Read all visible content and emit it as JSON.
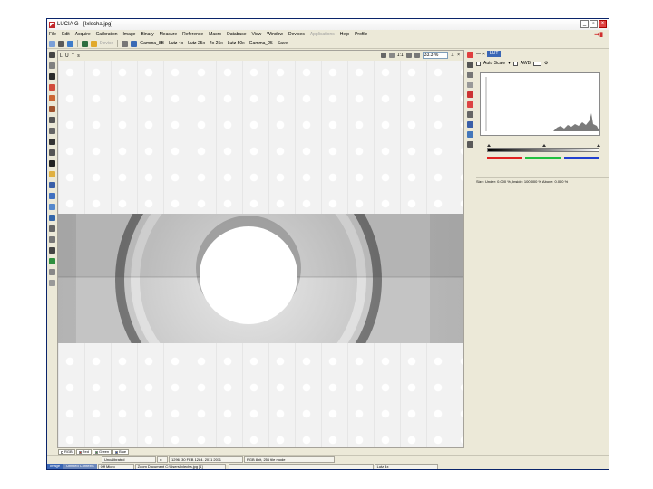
{
  "window": {
    "title": "LUCIA G - [Ixlecha.jpg]",
    "accent": "#c0282b"
  },
  "menu": [
    {
      "label": "File",
      "disabled": false
    },
    {
      "label": "Edit",
      "disabled": false
    },
    {
      "label": "Acquire",
      "disabled": false
    },
    {
      "label": "Calibration",
      "disabled": false
    },
    {
      "label": "Image",
      "disabled": false
    },
    {
      "label": "Binary",
      "disabled": false
    },
    {
      "label": "Measure",
      "disabled": false
    },
    {
      "label": "Reference",
      "disabled": false
    },
    {
      "label": "Macro",
      "disabled": false
    },
    {
      "label": "Database",
      "disabled": false
    },
    {
      "label": "View",
      "disabled": false
    },
    {
      "label": "Window",
      "disabled": false
    },
    {
      "label": "Devices",
      "disabled": false
    },
    {
      "label": "Applications",
      "disabled": true
    },
    {
      "label": "Help",
      "disabled": false
    },
    {
      "label": "Profile",
      "disabled": false
    }
  ],
  "toolbar": {
    "disabled_label": "Device",
    "presets": [
      "Gamma_8B",
      "Lutz 4x",
      "Lutz 25x",
      "4x 25x",
      "Lutz 50x",
      "Gamma_25",
      "Save"
    ]
  },
  "image": {
    "panel_title": "L U T s",
    "zoom_label": "1:1",
    "zoom_value": "33.3 %"
  },
  "image_tabs": [
    {
      "label": "RGB",
      "color": "#ffffff"
    },
    {
      "label": "Red",
      "color": "#d62828"
    },
    {
      "label": "Green",
      "color": "#2e9e3c"
    },
    {
      "label": "Blue",
      "color": "#2448c8"
    }
  ],
  "lut": {
    "tab_label": "LUT",
    "auto_scale": "Auto Scale",
    "awb": "AWB",
    "stats": "Size: Under: 0.000 %, Inside: 100.000 % Above: 0.000 %"
  },
  "status": {
    "calibration": "Uncalibrated",
    "pos_label": "x:",
    "pos_value": "1296. 30 FEB 1284. 2011 2011",
    "format": "RGB 8bit, 256 tile mode"
  },
  "bottom": {
    "tab1": "Image",
    "tab2": "Unfixed Contexts",
    "count": "Off Micro",
    "path": "Zoom Document C:\\Users\\Ixlecha.jpg [1]",
    "extra": "Lutz 4x"
  }
}
